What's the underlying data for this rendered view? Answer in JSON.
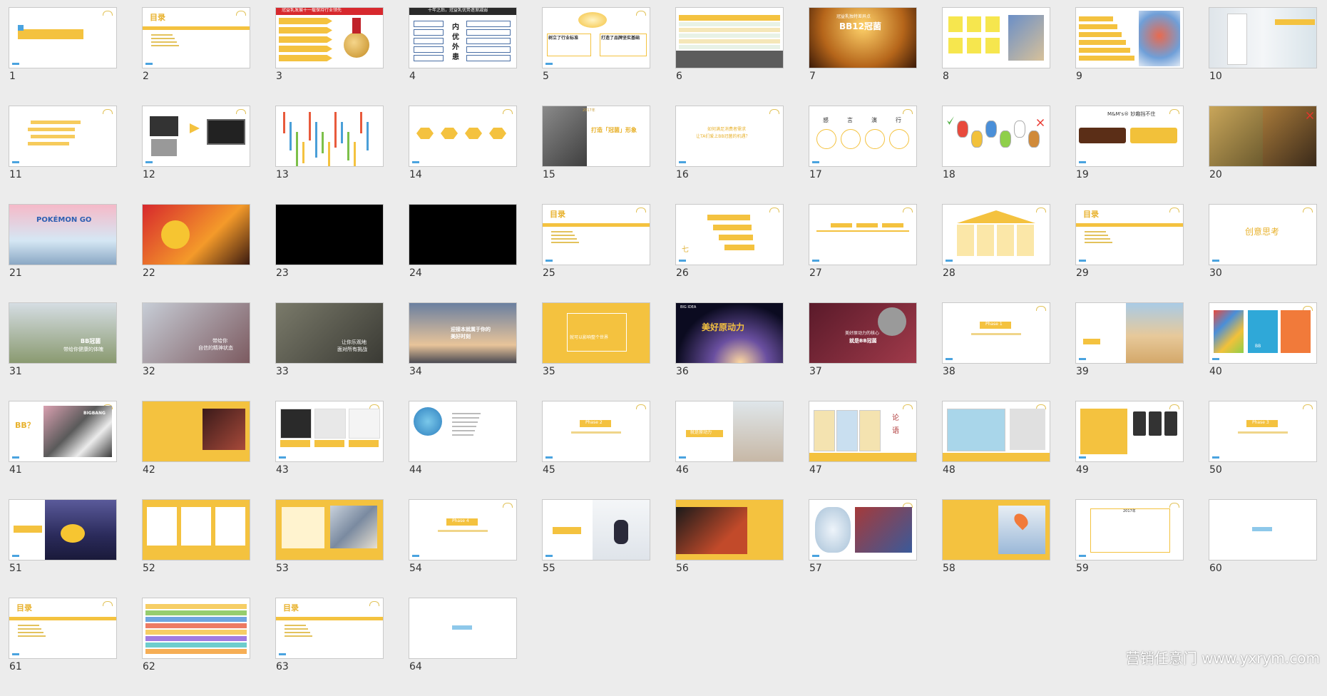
{
  "slides": [
    {
      "n": "1",
      "kind": "cover",
      "texts": []
    },
    {
      "n": "2",
      "kind": "toc",
      "texts": [
        "目录"
      ]
    },
    {
      "n": "3",
      "kind": "medal",
      "texts": [
        "冠益乳发展十一载保持行业领先"
      ]
    },
    {
      "n": "4",
      "kind": "inner",
      "texts": [
        "十年之后，冠益乳优势逐渐减弱",
        "内",
        "优",
        "外",
        "患"
      ]
    },
    {
      "n": "5",
      "kind": "twobox",
      "texts": [
        "树立了行业标准",
        "打造了品牌坚实基础"
      ]
    },
    {
      "n": "6",
      "kind": "table",
      "texts": []
    },
    {
      "n": "7",
      "kind": "gold",
      "texts": [
        "冠益乳独特差异点",
        "BB12冠菌"
      ]
    },
    {
      "n": "8",
      "kind": "notes",
      "texts": []
    },
    {
      "n": "9",
      "kind": "body",
      "texts": []
    },
    {
      "n": "10",
      "kind": "doctor",
      "texts": []
    },
    {
      "n": "11",
      "kind": "yellowtext",
      "texts": []
    },
    {
      "n": "12",
      "kind": "devices",
      "texts": []
    },
    {
      "n": "13",
      "kind": "tree",
      "texts": []
    },
    {
      "n": "14",
      "kind": "hexes",
      "texts": []
    },
    {
      "n": "15",
      "kind": "thumb",
      "texts": [
        "2017年",
        "打造「冠菌」形象"
      ]
    },
    {
      "n": "16",
      "kind": "question",
      "texts": [
        "如何满足消费者需求",
        "让TA们爱上BB冠菌的机遇？"
      ]
    },
    {
      "n": "17",
      "kind": "fourcircle",
      "texts": [
        "感",
        "言",
        "演",
        "行"
      ]
    },
    {
      "n": "18",
      "kind": "characters",
      "texts": []
    },
    {
      "n": "19",
      "kind": "mm",
      "texts": [
        "M&M's® 妙趣挡不住"
      ]
    },
    {
      "n": "20",
      "kind": "bear",
      "texts": []
    },
    {
      "n": "21",
      "kind": "pokemon",
      "texts": [
        "POKÉMON GO"
      ]
    },
    {
      "n": "22",
      "kind": "emoji",
      "texts": []
    },
    {
      "n": "23",
      "kind": "black",
      "texts": []
    },
    {
      "n": "24",
      "kind": "black",
      "texts": []
    },
    {
      "n": "25",
      "kind": "toc",
      "texts": [
        "目录"
      ]
    },
    {
      "n": "26",
      "kind": "plan",
      "texts": [
        "七"
      ]
    },
    {
      "n": "27",
      "kind": "timeline",
      "texts": []
    },
    {
      "n": "28",
      "kind": "house",
      "texts": []
    },
    {
      "n": "29",
      "kind": "toc",
      "texts": [
        "目录"
      ]
    },
    {
      "n": "30",
      "kind": "title",
      "texts": [
        "创意思考"
      ]
    },
    {
      "n": "31",
      "kind": "runner",
      "texts": [
        "BB冠菌",
        "带给你健康的体魄"
      ]
    },
    {
      "n": "32",
      "kind": "woman",
      "texts": [
        "带给你",
        "自信的精神状态"
      ]
    },
    {
      "n": "33",
      "kind": "climber",
      "texts": [
        "让你乐观地",
        "面对所有挑战"
      ]
    },
    {
      "n": "34",
      "kind": "sky",
      "texts": [
        "迎接本就属于你的",
        "美好时刻"
      ]
    },
    {
      "n": "35",
      "kind": "framed",
      "texts": [
        "就可以影响整个世界"
      ]
    },
    {
      "n": "36",
      "kind": "space",
      "texts": [
        "BIG IDEA",
        "美好原动力"
      ]
    },
    {
      "n": "37",
      "kind": "virus",
      "texts": [
        "美好原动力的核心",
        "就是BB冠菌"
      ]
    },
    {
      "n": "38",
      "kind": "phase",
      "texts": [
        "Phase 1"
      ]
    },
    {
      "n": "39",
      "kind": "desert",
      "texts": []
    },
    {
      "n": "40",
      "kind": "books",
      "texts": [
        "BB"
      ]
    },
    {
      "n": "41",
      "kind": "bb",
      "texts": [
        "BB？",
        "BIGBANG"
      ]
    },
    {
      "n": "42",
      "kind": "concert",
      "texts": []
    },
    {
      "n": "43",
      "kind": "three",
      "texts": []
    },
    {
      "n": "44",
      "kind": "globe",
      "texts": []
    },
    {
      "n": "45",
      "kind": "phase",
      "texts": [
        "Phase 2"
      ]
    },
    {
      "n": "46",
      "kind": "girl",
      "texts": [
        "就是原动力"
      ]
    },
    {
      "n": "47",
      "kind": "comic",
      "texts": [
        "论",
        "语"
      ]
    },
    {
      "n": "48",
      "kind": "comic2",
      "texts": []
    },
    {
      "n": "49",
      "kind": "phones",
      "texts": []
    },
    {
      "n": "50",
      "kind": "phase",
      "texts": [
        "Phase 3"
      ]
    },
    {
      "n": "51",
      "kind": "duck",
      "texts": []
    },
    {
      "n": "52",
      "kind": "apps",
      "texts": []
    },
    {
      "n": "53",
      "kind": "collage",
      "texts": []
    },
    {
      "n": "54",
      "kind": "phase",
      "texts": [
        "Phase 4"
      ]
    },
    {
      "n": "55",
      "kind": "snow",
      "texts": []
    },
    {
      "n": "56",
      "kind": "movie",
      "texts": []
    },
    {
      "n": "57",
      "kind": "globe2",
      "texts": []
    },
    {
      "n": "58",
      "kind": "map",
      "texts": []
    },
    {
      "n": "59",
      "kind": "ending",
      "texts": [
        "2017年"
      ]
    },
    {
      "n": "60",
      "kind": "blank",
      "texts": []
    },
    {
      "n": "61",
      "kind": "toc",
      "texts": [
        "目录"
      ]
    },
    {
      "n": "62",
      "kind": "schedule",
      "texts": []
    },
    {
      "n": "63",
      "kind": "toc",
      "texts": [
        "目录"
      ]
    },
    {
      "n": "64",
      "kind": "blank",
      "texts": []
    }
  ],
  "colors": {
    "accent": "#f4c23f",
    "accent_text": "#e8b22e",
    "tag": "#4aa3df",
    "red": "#d7282d"
  },
  "watermark": "营销任意门 www.yxrym.com"
}
